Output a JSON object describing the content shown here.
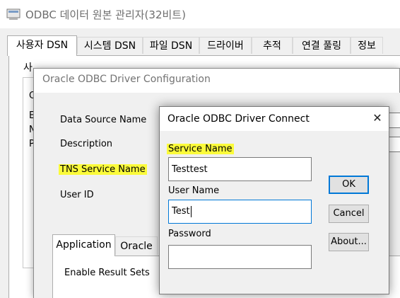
{
  "admin_window": {
    "title": "ODBC 데이터 원본 관리자(32비트)",
    "tabs": [
      {
        "label": "사용자 DSN",
        "selected": true
      },
      {
        "label": "시스템 DSN",
        "selected": false
      },
      {
        "label": "파일 DSN",
        "selected": false
      },
      {
        "label": "드라이버",
        "selected": false
      },
      {
        "label": "추적",
        "selected": false
      },
      {
        "label": "연결 풀링",
        "selected": false
      },
      {
        "label": "정보",
        "selected": false
      }
    ],
    "panel_label_fragment": "사",
    "list_fragments": [
      "O",
      "E",
      "N",
      "P"
    ]
  },
  "config_window": {
    "title": "Oracle ODBC Driver Configuration",
    "labels": {
      "data_source_name": "Data Source Name",
      "description": "Description",
      "tns_service_name": "TNS Service Name",
      "user_id": "User ID"
    },
    "tabs": [
      {
        "label": "Application",
        "selected": true
      },
      {
        "label": "Oracle",
        "selected": false
      }
    ],
    "enable_result_sets": "Enable Result Sets",
    "cutoff_text": "Or"
  },
  "connect_dialog": {
    "title": "Oracle ODBC Driver Connect",
    "close_glyph": "✕",
    "service_name_label": "Service Name",
    "service_name_value": "Testtest",
    "user_name_label": "User Name",
    "user_name_value": "Test",
    "password_label": "Password",
    "password_value": "",
    "buttons": {
      "ok": "OK",
      "cancel": "Cancel",
      "about": "About..."
    }
  },
  "colors": {
    "highlight": "#fbfb3a",
    "focus": "#0078d7"
  }
}
